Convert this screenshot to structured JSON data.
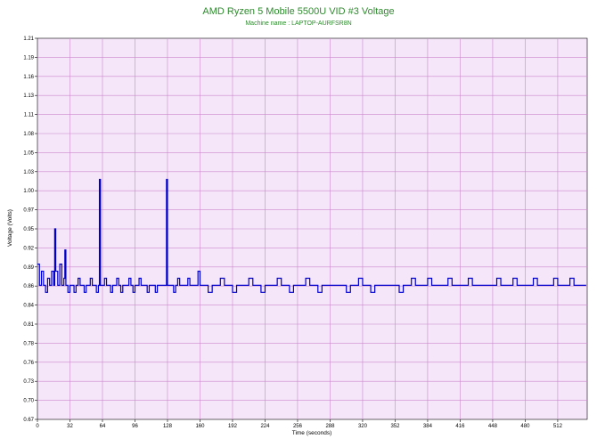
{
  "chart_data": {
    "type": "line",
    "title": "AMD Ryzen 5 Mobile 5500U VID #3 Voltage",
    "subtitle": "Machine name : LAPTOP-AURFSR8N",
    "xlabel": "Time (seconds)",
    "ylabel": "Voltage (Volts)",
    "xlim": [
      0,
      541
    ],
    "ylim": [
      0.67,
      1.21
    ],
    "x_ticks": [
      0,
      32,
      64,
      96,
      128,
      160,
      192,
      224,
      256,
      288,
      320,
      352,
      384,
      416,
      448,
      480,
      512
    ],
    "y_ticks": [
      0.67,
      0.7,
      0.73,
      0.76,
      0.78,
      0.81,
      0.84,
      0.86,
      0.89,
      0.92,
      0.95,
      0.97,
      1.0,
      1.03,
      1.05,
      1.08,
      1.11,
      1.13,
      1.16,
      1.19,
      1.21
    ],
    "grid": true,
    "colors": {
      "plot_background": "#f5e6fa",
      "grid": "#cc88cc",
      "line": "#0000cc",
      "title": "#2e8b2e"
    },
    "series": [
      {
        "name": "",
        "x": [
          0,
          2,
          4,
          6,
          8,
          10,
          12,
          14,
          16,
          17,
          18,
          20,
          22,
          24,
          26,
          27,
          28,
          30,
          32,
          34,
          36,
          38,
          40,
          42,
          44,
          46,
          48,
          50,
          52,
          54,
          56,
          58,
          60,
          61,
          62,
          64,
          66,
          68,
          70,
          72,
          74,
          76,
          78,
          80,
          82,
          84,
          86,
          88,
          90,
          92,
          94,
          96,
          98,
          100,
          102,
          104,
          106,
          108,
          110,
          112,
          114,
          116,
          118,
          120,
          122,
          124,
          126,
          127,
          128,
          130,
          132,
          134,
          136,
          138,
          140,
          142,
          144,
          146,
          148,
          150,
          152,
          154,
          156,
          158,
          160,
          164,
          168,
          172,
          176,
          180,
          184,
          188,
          192,
          196,
          200,
          204,
          208,
          212,
          216,
          220,
          224,
          228,
          232,
          236,
          240,
          244,
          248,
          252,
          256,
          260,
          264,
          268,
          272,
          276,
          280,
          284,
          288,
          292,
          296,
          300,
          304,
          308,
          312,
          316,
          320,
          324,
          328,
          332,
          336,
          340,
          344,
          348,
          352,
          356,
          360,
          364,
          368,
          372,
          376,
          380,
          384,
          388,
          392,
          396,
          400,
          404,
          408,
          412,
          416,
          420,
          424,
          428,
          432,
          436,
          440,
          444,
          448,
          452,
          456,
          460,
          464,
          468,
          472,
          476,
          480,
          484,
          488,
          492,
          496,
          500,
          504,
          508,
          512,
          516,
          520,
          524,
          528,
          532,
          536,
          540
        ],
        "y": [
          0.89,
          0.86,
          0.88,
          0.86,
          0.85,
          0.87,
          0.86,
          0.88,
          0.86,
          0.94,
          0.88,
          0.86,
          0.89,
          0.86,
          0.87,
          0.91,
          0.86,
          0.85,
          0.86,
          0.86,
          0.85,
          0.86,
          0.87,
          0.86,
          0.86,
          0.85,
          0.86,
          0.86,
          0.87,
          0.86,
          0.86,
          0.85,
          0.86,
          1.01,
          0.86,
          0.86,
          0.87,
          0.86,
          0.86,
          0.85,
          0.86,
          0.86,
          0.87,
          0.86,
          0.85,
          0.86,
          0.86,
          0.86,
          0.87,
          0.86,
          0.85,
          0.86,
          0.86,
          0.87,
          0.86,
          0.86,
          0.86,
          0.85,
          0.86,
          0.86,
          0.86,
          0.85,
          0.86,
          0.86,
          0.86,
          0.86,
          0.86,
          1.01,
          0.86,
          0.86,
          0.86,
          0.85,
          0.86,
          0.87,
          0.86,
          0.86,
          0.86,
          0.86,
          0.87,
          0.86,
          0.86,
          0.86,
          0.86,
          0.88,
          0.86,
          0.86,
          0.85,
          0.86,
          0.86,
          0.87,
          0.86,
          0.86,
          0.85,
          0.86,
          0.86,
          0.86,
          0.87,
          0.86,
          0.86,
          0.85,
          0.86,
          0.86,
          0.86,
          0.87,
          0.86,
          0.86,
          0.85,
          0.86,
          0.86,
          0.86,
          0.87,
          0.86,
          0.86,
          0.85,
          0.86,
          0.86,
          0.86,
          0.86,
          0.86,
          0.86,
          0.85,
          0.86,
          0.86,
          0.87,
          0.86,
          0.86,
          0.85,
          0.86,
          0.86,
          0.86,
          0.86,
          0.86,
          0.86,
          0.85,
          0.86,
          0.86,
          0.87,
          0.86,
          0.86,
          0.86,
          0.87,
          0.86,
          0.86,
          0.86,
          0.86,
          0.87,
          0.86,
          0.86,
          0.86,
          0.86,
          0.87,
          0.86,
          0.86,
          0.86,
          0.86,
          0.86,
          0.86,
          0.87,
          0.86,
          0.86,
          0.86,
          0.87,
          0.86,
          0.86,
          0.86,
          0.86,
          0.87,
          0.86,
          0.86,
          0.86,
          0.86,
          0.87,
          0.86,
          0.86,
          0.86,
          0.87,
          0.86,
          0.86,
          0.86,
          0.86
        ]
      }
    ]
  }
}
